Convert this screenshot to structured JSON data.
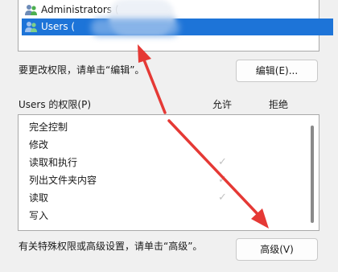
{
  "groups": {
    "items": [
      {
        "label": "Administrators (",
        "selected": false
      },
      {
        "label": "Users (",
        "selected": true
      }
    ]
  },
  "edit_hint": "要更改权限，请单击“编辑”。",
  "edit_button": "编辑(E)...",
  "permissions": {
    "label": "Users 的权限(P)",
    "allow_header": "允许",
    "deny_header": "拒绝",
    "rows": [
      {
        "name": "完全控制",
        "allow": false,
        "deny": false
      },
      {
        "name": "修改",
        "allow": false,
        "deny": false
      },
      {
        "name": "读取和执行",
        "allow": true,
        "deny": false
      },
      {
        "name": "列出文件夹内容",
        "allow": true,
        "deny": false
      },
      {
        "name": "读取",
        "allow": true,
        "deny": false
      },
      {
        "name": "写入",
        "allow": false,
        "deny": false
      }
    ],
    "check_glyph": "✓"
  },
  "advanced_hint": "有关特殊权限或高级设置，请单击“高级”。",
  "advanced_button": "高级(V)",
  "colors": {
    "selection": "#1d74d8",
    "arrow": "#e53935",
    "check": "#c2c2c2"
  },
  "icons": [
    "user-group-icon",
    "arrow-annotation"
  ]
}
